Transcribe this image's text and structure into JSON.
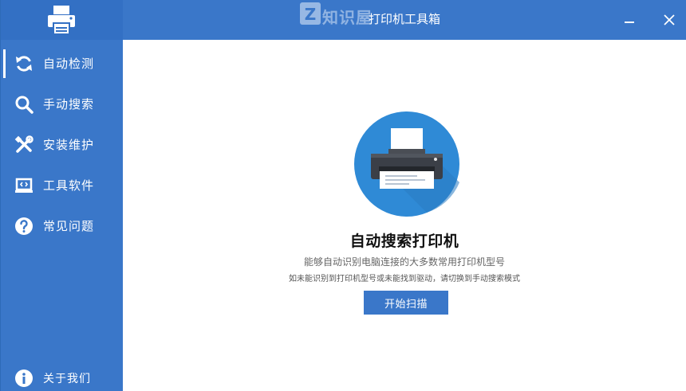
{
  "window": {
    "title": "打印机工具箱",
    "watermark_text": "知识屋",
    "watermark_letter": "Z"
  },
  "sidebar": {
    "items": [
      {
        "label": "自动检测",
        "icon": "refresh-icon",
        "active": true
      },
      {
        "label": "手动搜索",
        "icon": "search-icon",
        "active": false
      },
      {
        "label": "安装维护",
        "icon": "tools-icon",
        "active": false
      },
      {
        "label": "工具软件",
        "icon": "laptop-code-icon",
        "active": false
      },
      {
        "label": "常见问题",
        "icon": "help-icon",
        "active": false
      }
    ],
    "about_label": "关于我们"
  },
  "main": {
    "heading": "自动搜索打印机",
    "subtitle1": "能够自动识别电脑连接的大多数常用打印机型号",
    "subtitle2": "如未能识别到打印机型号或未能找到驱动，请切换到手动搜索模式",
    "scan_button": "开始扫描"
  },
  "colors": {
    "accent": "#3a77c9",
    "sidebar": "#3a77c9",
    "circle": "#2f8ad6"
  }
}
